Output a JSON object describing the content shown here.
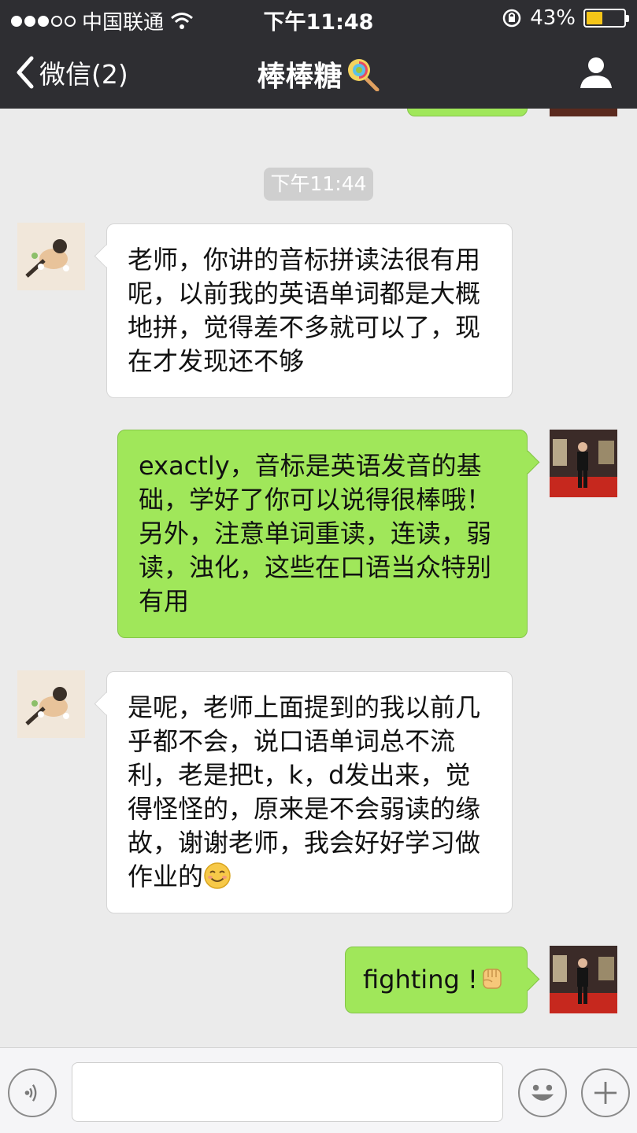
{
  "status_bar": {
    "carrier": "中国联通",
    "time": "下午11:48",
    "battery": "43%",
    "battery_level": 0.43
  },
  "nav": {
    "back_label": "微信(2)",
    "title": "棒棒糖"
  },
  "chat": {
    "timestamp": "下午11:44",
    "messages": [
      {
        "side": "in",
        "text": "老师，你讲的音标拼读法很有用呢，以前我的英语单词都是大概地拼，觉得差不多就可以了，现在才发现还不够"
      },
      {
        "side": "out",
        "text": "exactly，音标是英语发音的基础，学好了你可以说得很棒哦！另外，注意单词重读，连读，弱读，浊化，这些在口语当众特别有用"
      },
      {
        "side": "in",
        "text": "是呢，老师上面提到的我以前几乎都不会，说口语单词总不流利，老是把t，k，d发出来，觉得怪怪的，原来是不会弱读的缘故，谢谢老师，我会好好学习做作业的"
      },
      {
        "side": "out",
        "text": "fighting !"
      }
    ]
  },
  "icons": {
    "back": "chevron-left-icon",
    "title_emoji": "lollipop-icon",
    "profile": "person-icon",
    "voice": "voice-icon",
    "emoji": "smiley-icon",
    "more": "plus-icon",
    "smile_emoji": "smiling-face-emoji",
    "fist_emoji": "raised-fist-emoji"
  },
  "colors": {
    "header_bg": "#2e2e32",
    "chat_bg": "#ebebeb",
    "outgoing_bubble": "#a0e75a",
    "incoming_bubble": "#ffffff"
  }
}
